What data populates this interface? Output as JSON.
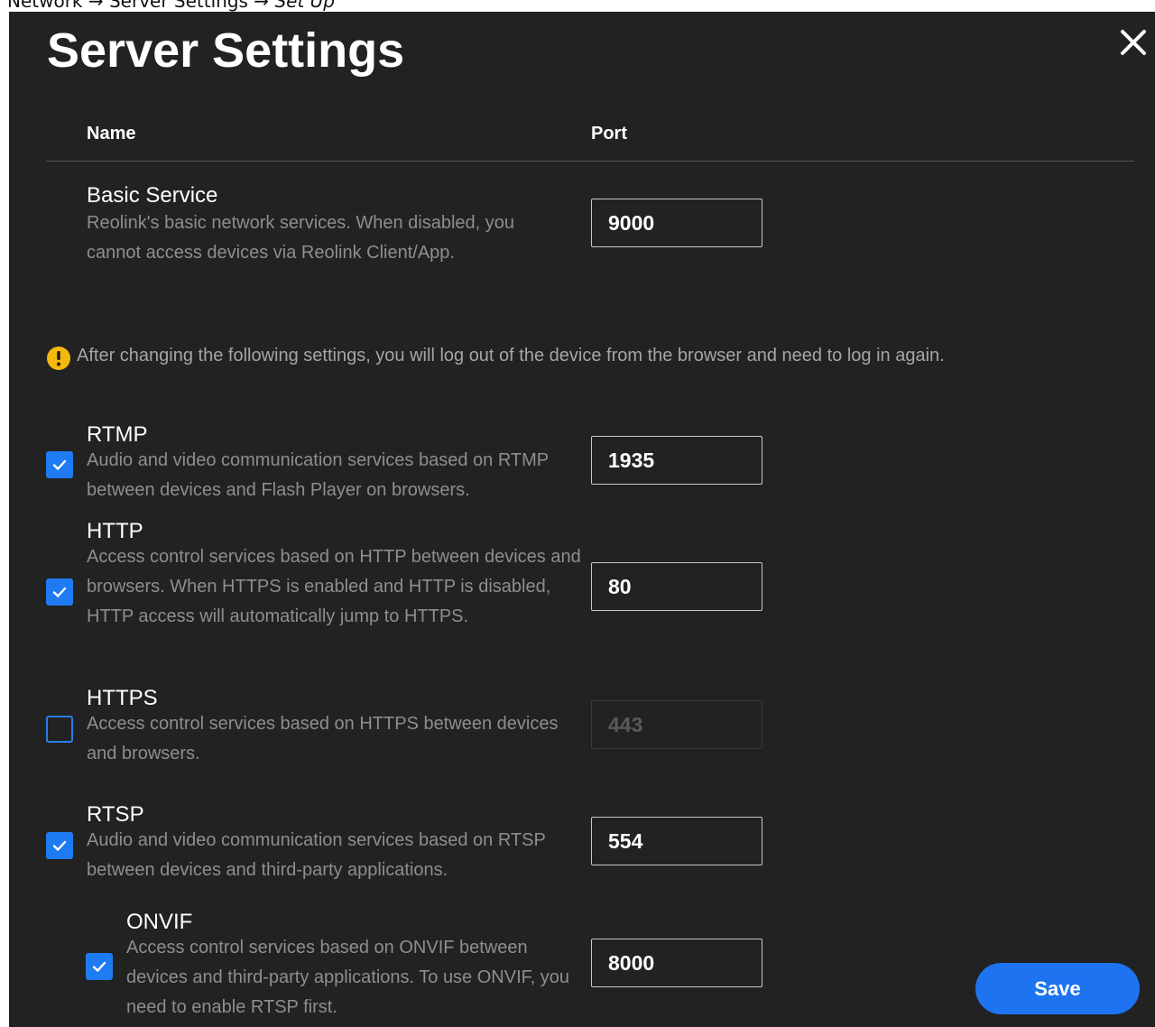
{
  "breadcrumb": {
    "path": "Network → Server Settings → ",
    "current": "Set Up"
  },
  "dialog": {
    "title": "Server Settings",
    "columns": {
      "name": "Name",
      "port": "Port"
    },
    "warning": "After changing the following settings, you will log out of the device from the browser and need to log in again.",
    "save_label": "Save"
  },
  "services": {
    "basic": {
      "name": "Basic Service",
      "description": "Reolink's basic network services. When disabled, you cannot access devices via Reolink Client/App.",
      "port": "9000"
    },
    "rtmp": {
      "name": "RTMP",
      "description": "Audio and video communication services based on RTMP between devices and Flash Player on browsers.",
      "port": "1935",
      "enabled": true
    },
    "http": {
      "name": "HTTP",
      "description": "Access control services based on HTTP between devices and browsers. When HTTPS is enabled and HTTP is disabled, HTTP access will automatically jump to HTTPS.",
      "port": "80",
      "enabled": true
    },
    "https": {
      "name": "HTTPS",
      "description": "Access control services based on HTTPS between devices and browsers.",
      "port": "443",
      "enabled": false
    },
    "rtsp": {
      "name": "RTSP",
      "description": "Audio and video communication services based on RTSP between devices and third-party applications.",
      "port": "554",
      "enabled": true
    },
    "onvif": {
      "name": "ONVIF",
      "description": "Access control services based on ONVIF between devices and third-party applications. To use ONVIF, you need to enable RTSP first.",
      "port": "8000",
      "enabled": true
    }
  },
  "icons": {
    "close": "close-icon",
    "warning": "warning-icon",
    "check": "checkmark-icon"
  },
  "colors": {
    "background": "#222222",
    "accent": "#1e74f0",
    "warning": "#f5b80d"
  }
}
